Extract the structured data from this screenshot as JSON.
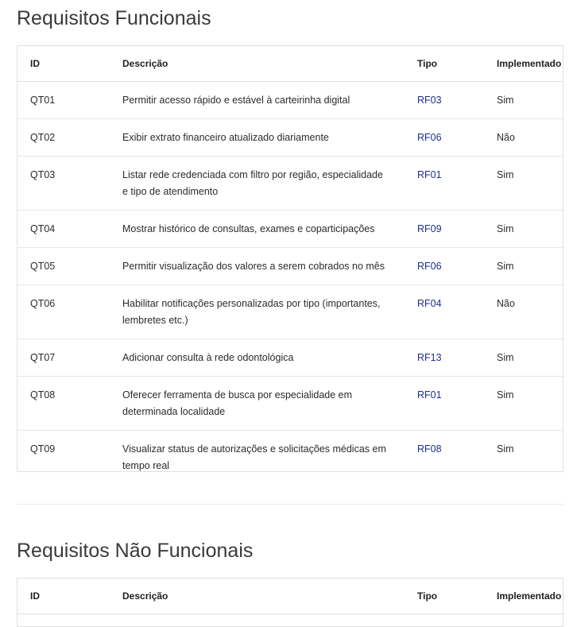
{
  "sections": [
    {
      "title": "Requisitos Funcionais",
      "columns": [
        "ID",
        "Descrição",
        "Tipo",
        "Implementado"
      ],
      "rows": [
        {
          "id": "QT01",
          "desc": "Permitir acesso rápido e estável à carteirinha digital",
          "type": "RF03",
          "impl": "Sim"
        },
        {
          "id": "QT02",
          "desc": "Exibir extrato financeiro atualizado diariamente",
          "type": "RF06",
          "impl": "Não"
        },
        {
          "id": "QT03",
          "desc": "Listar rede credenciada com filtro por região, especialidade e tipo de atendimento",
          "type": "RF01",
          "impl": "Sim"
        },
        {
          "id": "QT04",
          "desc": "Mostrar histórico de consultas, exames e coparticipações",
          "type": "RF09",
          "impl": "Sim"
        },
        {
          "id": "QT05",
          "desc": "Permitir visualização dos valores a serem cobrados no mês",
          "type": "RF06",
          "impl": "Sim"
        },
        {
          "id": "QT06",
          "desc": "Habilitar notificações personalizadas por tipo (importantes, lembretes etc.)",
          "type": "RF04",
          "impl": "Não"
        },
        {
          "id": "QT07",
          "desc": "Adicionar consulta à rede odontológica",
          "type": "RF13",
          "impl": "Sim"
        },
        {
          "id": "QT08",
          "desc": "Oferecer ferramenta de busca por especialidade em determinada localidade",
          "type": "RF01",
          "impl": "Sim"
        },
        {
          "id": "QT09",
          "desc": "Visualizar status de autorizações e solicitações médicas em tempo real",
          "type": "RF08",
          "impl": "Sim"
        }
      ]
    },
    {
      "title": "Requisitos Não Funcionais",
      "columns": [
        "ID",
        "Descrição",
        "Tipo",
        "Implementado"
      ]
    }
  ],
  "colors": {
    "type_link": "#1f2f8a",
    "border": "#e0e0e0",
    "text": "#2b2b2b"
  }
}
